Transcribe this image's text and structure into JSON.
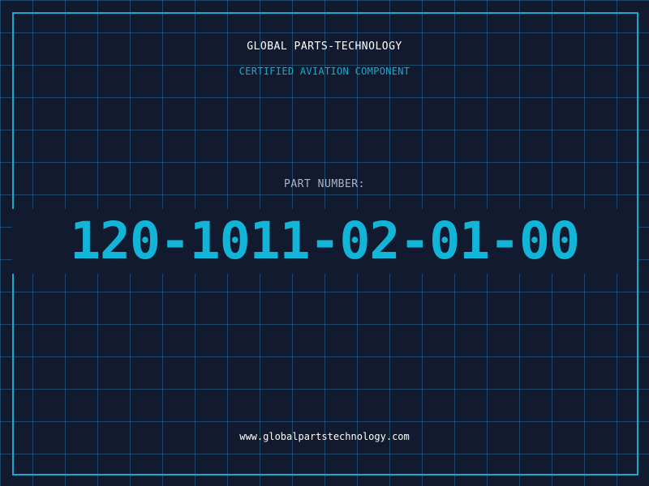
{
  "header": {
    "company": "GLOBAL PARTS-TECHNOLOGY",
    "subtitle": "CERTIFIED AVIATION COMPONENT"
  },
  "part": {
    "label": "PART NUMBER:",
    "number": "120-1011-02-01-00"
  },
  "footer": {
    "website": "www.globalpartstechnology.com"
  },
  "colors": {
    "background": "#111a2e",
    "grid": "#286e96",
    "accent": "#1aa9cc",
    "part_number": "#12b4d8",
    "label": "#a9b7c8",
    "text": "#ffffff"
  }
}
